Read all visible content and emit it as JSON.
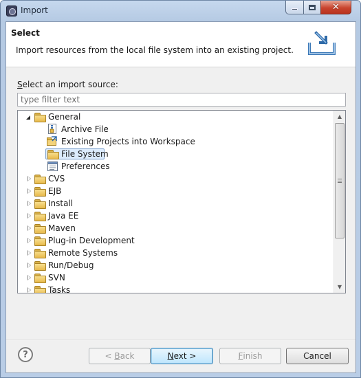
{
  "window": {
    "title": "Import"
  },
  "header": {
    "title": "Select",
    "description": "Import resources from the local file system into an existing project."
  },
  "source": {
    "label_prefix": "S",
    "label_rest": "elect an import source:",
    "filter_placeholder": "type filter text"
  },
  "tree": {
    "general": {
      "label": "General",
      "expanded": true,
      "children": [
        {
          "label": "Archive File",
          "icon": "archive-file-icon"
        },
        {
          "label": "Existing Projects into Workspace",
          "icon": "existing-projects-icon"
        },
        {
          "label": "File System",
          "icon": "folder-icon",
          "selected": true
        },
        {
          "label": "Preferences",
          "icon": "preferences-icon"
        }
      ]
    },
    "items": [
      {
        "label": "CVS"
      },
      {
        "label": "EJB"
      },
      {
        "label": "Install"
      },
      {
        "label": "Java EE"
      },
      {
        "label": "Maven"
      },
      {
        "label": "Plug-in Development"
      },
      {
        "label": "Remote Systems"
      },
      {
        "label": "Run/Debug"
      },
      {
        "label": "SVN"
      },
      {
        "label": "Tasks"
      }
    ]
  },
  "buttons": {
    "back_prefix": "< ",
    "back_mnemonic": "B",
    "back_rest": "ack",
    "next_prefix": "",
    "next_mnemonic": "N",
    "next_rest": "ext >",
    "finish_mnemonic": "F",
    "finish_rest": "inish",
    "cancel": "Cancel"
  },
  "colors": {
    "selection": "#dcebfc",
    "close_button": "#c9452f",
    "folder": "#f0c85c"
  }
}
